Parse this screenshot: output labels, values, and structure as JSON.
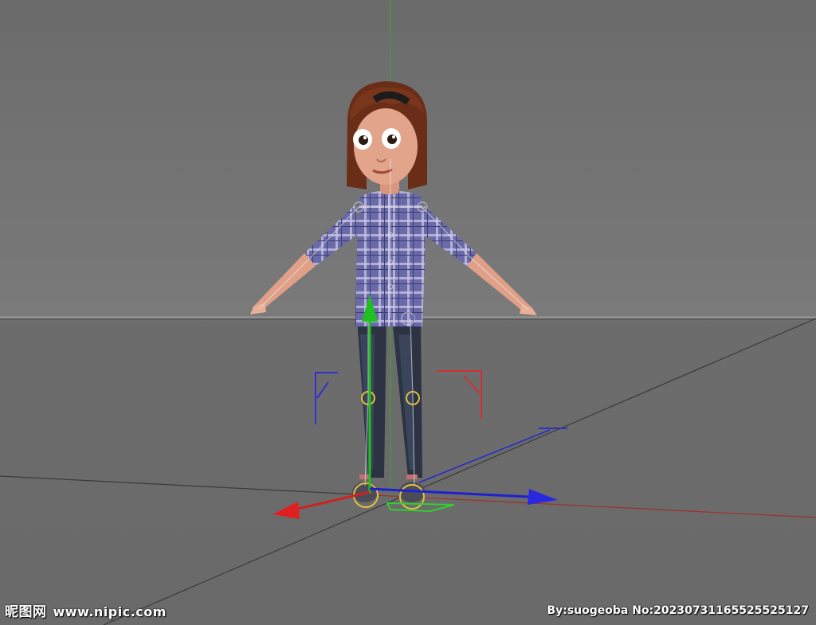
{
  "watermark": {
    "brand": "昵图网",
    "site": "www.nipic.com",
    "credit": "By:suogeoba No:20230731165525525127"
  },
  "colors": {
    "background": "#6e6e6e",
    "x_axis": "#e02020",
    "y_axis": "#20c020",
    "z_axis": "#2020e0",
    "joint": "#e0c040"
  }
}
